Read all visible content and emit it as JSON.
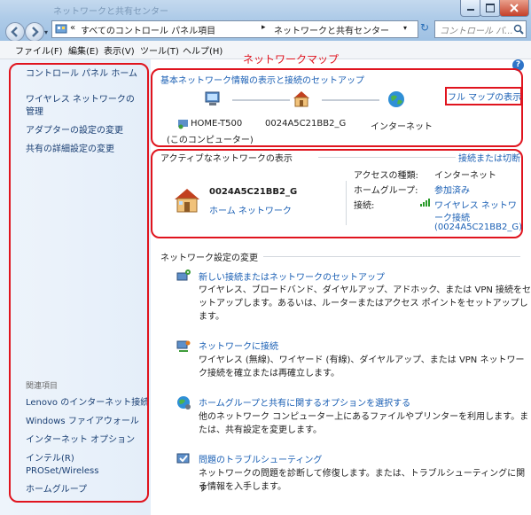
{
  "window": {
    "title_text": "ネットワークと共有センター",
    "accent": "#e0141e",
    "link_color": "#1a5fb4"
  },
  "address": {
    "prefix": "«",
    "crumb1": "すべてのコントロール パネル項目",
    "arrow": "▸",
    "crumb2": "ネットワークと共有センター",
    "search_placeholder": "コントロール パ..."
  },
  "menu": {
    "file": "ファイル(F)",
    "edit": "編集(E)",
    "view": "表示(V)",
    "tools": "ツール(T)",
    "help": "ヘルプ(H)"
  },
  "sidebar": {
    "home": "コントロール パネル ホーム",
    "wireless": "ワイヤレス ネットワークの管理",
    "adapter": "アダプターの設定の変更",
    "sharing": "共有の詳細設定の変更",
    "related_header": "関連項目",
    "related": [
      "Lenovo のインターネット接続",
      "Windows ファイアウォール",
      "インターネット オプション",
      "インテル(R) PROSet/Wireless",
      "ホームグループ"
    ]
  },
  "annotation": "ネットワークマップ",
  "network_map": {
    "heading": "基本ネットワーク情報の表示と接続のセットアップ",
    "full_map_link": "フル マップの表示",
    "computer_name": "HOME-T500",
    "computer_sub": "(このコンピューター)",
    "router_name": "0024A5C21BB2_G",
    "internet_name": "インターネット"
  },
  "active": {
    "heading": "アクティブなネットワークの表示",
    "connect_link": "接続または切断",
    "network_name": "0024A5C21BB2_G",
    "network_type": "ホーム ネットワーク",
    "access_label": "アクセスの種類:",
    "access_value": "インターネット",
    "homegroup_label": "ホームグループ:",
    "homegroup_value": "参加済み",
    "connection_label": "接続:",
    "connection_value_1": "ワイヤレス ネットワ",
    "connection_value_2": "ーク接続",
    "connection_value_3": "(0024A5C21BB2_G)"
  },
  "settings": {
    "heading": "ネットワーク設定の変更",
    "items": [
      {
        "title": "新しい接続またはネットワークのセットアップ",
        "line1": "ワイヤレス、ブロードバンド、ダイヤルアップ、アドホック、または VPN 接続をセ",
        "line2": "ットアップします。あるいは、ルーターまたはアクセス ポイントをセットアップし",
        "line3": "ます。"
      },
      {
        "title": "ネットワークに接続",
        "line1": "ワイヤレス (無線)、ワイヤード (有線)、ダイヤルアップ、または VPN ネットワー",
        "line2": "ク接続を確立または再確立します。"
      },
      {
        "title": "ホームグループと共有に関するオプションを選択する",
        "line1": "他のネットワーク コンピューター上にあるファイルやプリンターを利用します。ま",
        "line2": "たは、共有設定を変更します。"
      },
      {
        "title": "問題のトラブルシューティング",
        "line1": "ネットワークの問題を診断して修復します。または、トラブルシューティングに関す",
        "line2": "る情報を入手します。"
      }
    ]
  }
}
